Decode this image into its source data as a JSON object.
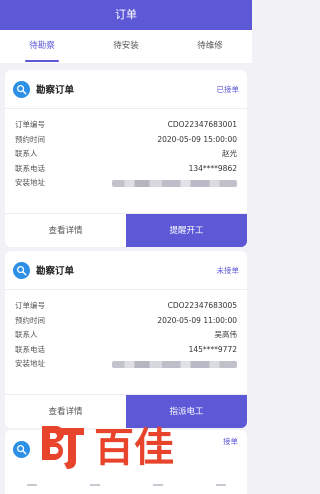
{
  "header": {
    "title": "订单"
  },
  "tabs": [
    {
      "label": "待勘察",
      "active": true
    },
    {
      "label": "待安装",
      "active": false
    },
    {
      "label": "待维修",
      "active": false
    }
  ],
  "orders": [
    {
      "title": "勘察订单",
      "status": "已接单",
      "fields": [
        {
          "label": "订单编号",
          "value": "CDO22347683001"
        },
        {
          "label": "预约时间",
          "value": "2020-05-09 15:00:00"
        },
        {
          "label": "联系人",
          "value": "赵光"
        },
        {
          "label": "联系电话",
          "value": "134****9862"
        },
        {
          "label": "安装地址",
          "value": ""
        }
      ],
      "detail_label": "查看详情",
      "action_label": "提醒开工"
    },
    {
      "title": "勘察订单",
      "status": "未接单",
      "fields": [
        {
          "label": "订单编号",
          "value": "CDO22347683005"
        },
        {
          "label": "预约时间",
          "value": "2020-05-09 11:00:00"
        },
        {
          "label": "联系人",
          "value": "吴高伟"
        },
        {
          "label": "联系电话",
          "value": "145****9772"
        },
        {
          "label": "安装地址",
          "value": ""
        }
      ],
      "detail_label": "查看详情",
      "action_label": "指派电工"
    }
  ],
  "partial_card": {
    "status": "接单"
  },
  "watermark": {
    "text": "百佳",
    "brand_color": "#e8442c"
  },
  "colors": {
    "accent": "#5c58d6",
    "icon_blue": "#2e8fe6",
    "background": "#f1f1f6"
  }
}
